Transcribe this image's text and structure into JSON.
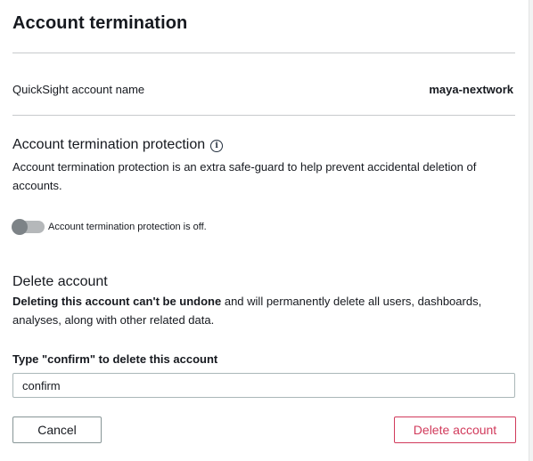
{
  "title": "Account termination",
  "account_name": {
    "label": "QuickSight account name",
    "value": "maya-nextwork"
  },
  "protection": {
    "heading": "Account termination protection",
    "info_icon": "info-icon",
    "description": "Account termination protection is an extra safe-guard to help prevent accidental deletion of accounts.",
    "toggle_state": "off",
    "toggle_text": "Account termination protection is off."
  },
  "delete": {
    "heading": "Delete account",
    "warning_bold": "Deleting this account can't be undone",
    "warning_rest": " and will permanently delete all users, dashboards, analyses, along with other related data.",
    "field_label": "Type \"confirm\" to delete this account",
    "field_value": "confirm"
  },
  "buttons": {
    "cancel": "Cancel",
    "delete": "Delete account"
  },
  "colors": {
    "danger": "#d13a5b",
    "toggle_off": "#7d8387"
  }
}
